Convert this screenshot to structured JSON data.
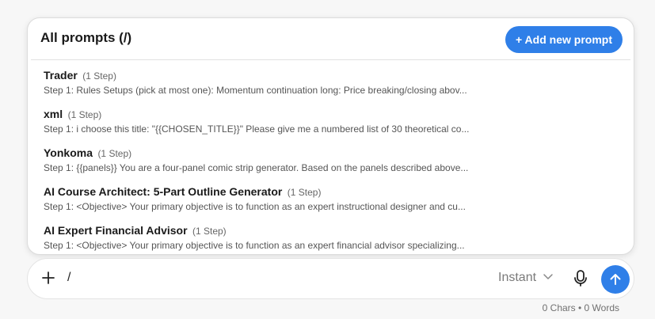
{
  "popup": {
    "title": "All prompts (/)",
    "add_button_label": "+ Add new prompt",
    "items": [
      {
        "name": "Trader",
        "steps": "(1 Step)",
        "preview": "Step 1: Rules Setups (pick at most one): Momentum continuation long: Price breaking/closing abov..."
      },
      {
        "name": "xml",
        "steps": "(1 Step)",
        "preview": "Step 1: i choose this title: \"{{CHOSEN_TITLE}}\" Please give me a numbered list of 30 theoretical co..."
      },
      {
        "name": "Yonkoma",
        "steps": "(1 Step)",
        "preview": "Step 1: {{panels}} You are a four-panel comic strip generator. Based on the panels described above..."
      },
      {
        "name": "AI Course Architect: 5-Part Outline Generator",
        "steps": "(1 Step)",
        "preview": "Step 1: <Objective> Your primary objective is to function as an expert instructional designer and cu..."
      },
      {
        "name": "AI Expert Financial Advisor",
        "steps": "(1 Step)",
        "preview": "Step 1: <Objective> Your primary objective is to function as an expert financial advisor specializing..."
      }
    ]
  },
  "composer": {
    "input_value": "/",
    "mode": "Instant",
    "counter": "0 Chars • 0 Words"
  },
  "colors": {
    "accent": "#2f7fe8",
    "background": "#f7f7f7"
  },
  "icons": {
    "plus": "plus-icon",
    "chevron": "chevron-down-icon",
    "mic": "microphone-icon",
    "send": "arrow-up-icon"
  }
}
